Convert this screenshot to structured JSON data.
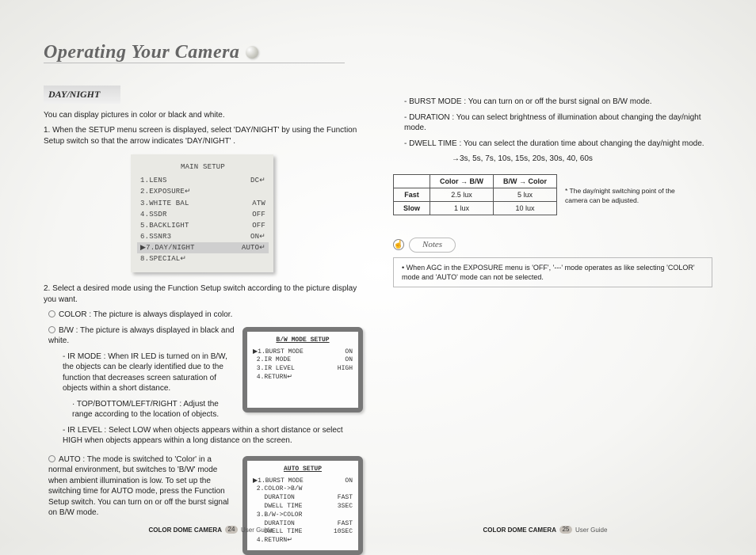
{
  "headline": "Operating Your Camera",
  "section": "DAY/NIGHT",
  "intro": "You can display pictures in color or black and white.",
  "step1": "1. When the SETUP menu screen is displayed, select 'DAY/NIGHT' by using the Function Setup switch so that the arrow indicates 'DAY/NIGHT' .",
  "main_menu": {
    "title": "MAIN SETUP",
    "rows": [
      {
        "l": "1.LENS",
        "r": "DC↵"
      },
      {
        "l": "2.EXPOSURE↵",
        "r": ""
      },
      {
        "l": "3.WHITE BAL",
        "r": "ATW"
      },
      {
        "l": "4.SSDR",
        "r": "OFF"
      },
      {
        "l": "5.BACKLIGHT",
        "r": "OFF"
      },
      {
        "l": "6.SSNR3",
        "r": "ON↵"
      },
      {
        "l": "▶7.DAY/NIGHT",
        "r": "AUTO↵",
        "sel": true
      },
      {
        "l": "8.SPECIAL↵",
        "r": ""
      }
    ]
  },
  "step2": "2. Select a desired mode using the Function Setup switch according to the picture display you want.",
  "color_line": "COLOR : The picture is always displayed in color.",
  "bw_line": "B/W : The picture is always displayed in black and white.",
  "ir_mode": "- IR MODE : When IR LED is turned on in B/W, the objects can be clearly identified due to the function that decreases screen saturation of objects within a short distance.",
  "ir_range": "· TOP/BOTTOM/LEFT/RIGHT : Adjust the range according to the location of objects.",
  "ir_level": "- IR LEVEL : Select LOW when objects appears within a short distance or select HIGH when objects appears within a long distance on the screen.",
  "osd1": {
    "title": "B/W MODE SETUP",
    "rows": [
      {
        "l": "▶1.BURST MODE",
        "r": "ON"
      },
      {
        "l": " 2.IR MODE",
        "r": "ON"
      },
      {
        "l": " 3.IR LEVEL",
        "r": "HIGH"
      },
      {
        "l": " 4.RETURN↵",
        "r": ""
      }
    ]
  },
  "auto_line": "AUTO : The mode is switched to 'Color' in a normal environment, but switches to 'B/W' mode when ambient illumination is low. To set up the switching time for AUTO mode, press the Function Setup switch. You can turn on or off the burst signal on B/W mode.",
  "osd2": {
    "title": "AUTO SETUP",
    "rows": [
      {
        "l": "▶1.BURST MODE",
        "r": "ON"
      },
      {
        "l": " 2.COLOR->B/W",
        "r": ""
      },
      {
        "l": "   DURATION",
        "r": "FAST"
      },
      {
        "l": "   DWELL TIME",
        "r": "3SEC"
      },
      {
        "l": " 3.B/W->COLOR",
        "r": ""
      },
      {
        "l": "   DURATION",
        "r": "FAST"
      },
      {
        "l": "   DWELL TIME",
        "r": "10SEC"
      },
      {
        "l": " 4.RETURN↵",
        "r": ""
      }
    ]
  },
  "right_bullets": {
    "burst": "- BURST MODE : You can turn on or off the burst signal on B/W mode.",
    "duration": "- DURATION : You can select brightness of illumination about changing the day/night mode.",
    "dwell": "- DWELL TIME : You can select the duration time about changing the day/night mode.",
    "dwell_vals": "→3s, 5s, 7s, 10s, 15s, 20s, 30s, 40, 60s"
  },
  "switch_table": {
    "h1": "Color → B/W",
    "h2": "B/W → Color",
    "r1": "Fast",
    "r1v1": "2.5 lux",
    "r1v2": "5 lux",
    "r2": "Slow",
    "r2v1": "1 lux",
    "r2v2": "10 lux",
    "note": "* The day/night switching point of the camera can be adjusted."
  },
  "notes_label": "Notes",
  "notes_body": "• When AGC in the EXPOSURE menu is 'OFF', '---' mode operates as like selecting 'COLOR' mode and 'AUTO' mode can not be selected.",
  "footer": {
    "brand": "COLOR DOME CAMERA",
    "guide": "User Guide",
    "p_left": "24",
    "p_right": "25"
  }
}
